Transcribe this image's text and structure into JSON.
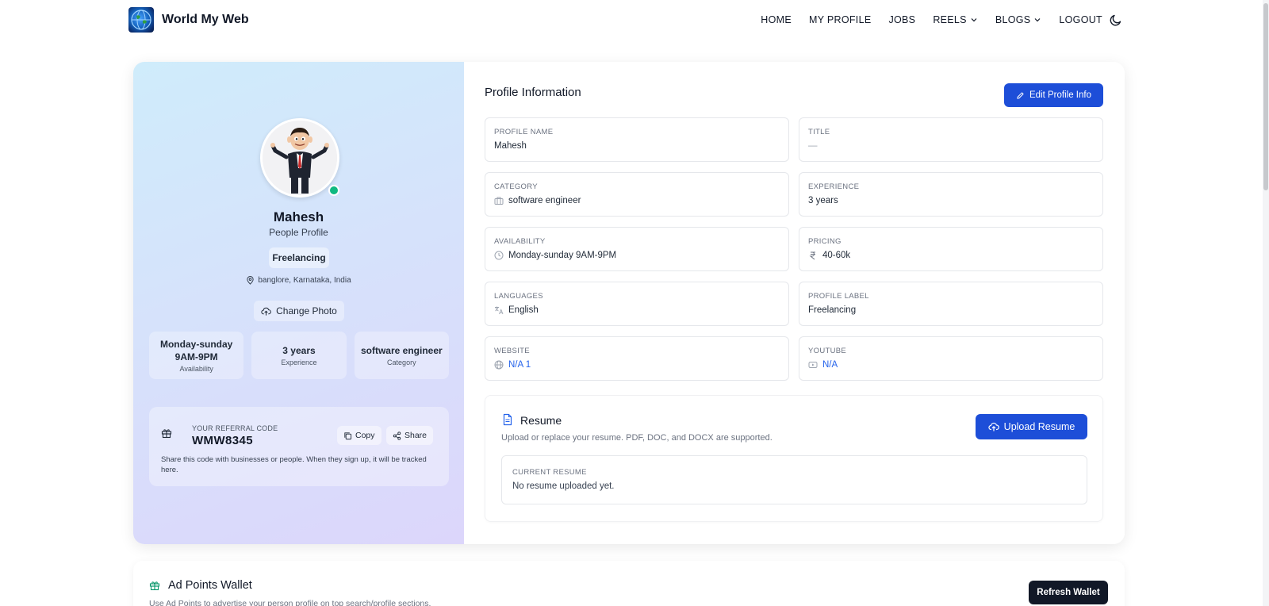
{
  "nav": {
    "brand": "World My Web",
    "items": [
      {
        "label": "HOME",
        "dropdown": false
      },
      {
        "label": "MY PROFILE",
        "dropdown": false
      },
      {
        "label": "JOBS",
        "dropdown": false
      },
      {
        "label": "REELS",
        "dropdown": true
      },
      {
        "label": "BLOGS",
        "dropdown": true
      },
      {
        "label": "LOGOUT",
        "dropdown": false
      }
    ],
    "theme_icon": "moon-icon"
  },
  "profile_card": {
    "name": "Mahesh",
    "type": "People Profile",
    "label": "Freelancing",
    "location": "banglore, Karnataka, India",
    "change_photo": "Change Photo",
    "online_color": "#10b981",
    "stats": [
      {
        "value": "Monday-sunday 9AM-9PM",
        "label": "Availability"
      },
      {
        "value": "3 years",
        "label": "Experience"
      },
      {
        "value": "software engineer",
        "label": "Category"
      }
    ],
    "referral": {
      "title": "YOUR REFERRAL CODE",
      "code": "WMW8345",
      "copy": "Copy",
      "share": "Share",
      "description": "Share this code with businesses or people. When they sign up, it will be tracked here."
    }
  },
  "profile_info": {
    "title": "Profile Information",
    "edit_button": "Edit Profile Info",
    "fields": [
      {
        "label": "PROFILE NAME",
        "value": "Mahesh",
        "icon": "",
        "link": false
      },
      {
        "label": "TITLE",
        "value": "—",
        "icon": "",
        "link": false
      },
      {
        "label": "CATEGORY",
        "value": "software engineer",
        "icon": "briefcase-icon",
        "link": false
      },
      {
        "label": "EXPERIENCE",
        "value": "3 years",
        "icon": "",
        "link": false
      },
      {
        "label": "AVAILABILITY",
        "value": "Monday-sunday 9AM-9PM",
        "icon": "clock-icon",
        "link": false
      },
      {
        "label": "PRICING",
        "value": "40-60k",
        "icon": "rupee-icon",
        "link": false
      },
      {
        "label": "LANGUAGES",
        "value": "English",
        "icon": "translate-icon",
        "link": false
      },
      {
        "label": "PROFILE LABEL",
        "value": "Freelancing",
        "icon": "",
        "link": false
      },
      {
        "label": "WEBSITE",
        "value": "N/A 1",
        "icon": "globe-icon",
        "link": true
      },
      {
        "label": "YOUTUBE",
        "value": "N/A",
        "icon": "youtube-icon",
        "link": true
      }
    ]
  },
  "resume": {
    "title": "Resume",
    "subtitle": "Upload or replace your resume. PDF, DOC, and DOCX are supported.",
    "upload_button": "Upload Resume",
    "current_label": "CURRENT RESUME",
    "current_value": "No resume uploaded yet."
  },
  "wallet": {
    "title": "Ad Points Wallet",
    "subtitle": "Use Ad Points to advertise your person profile on top search/profile sections.",
    "refresh_button": "Refresh Wallet"
  },
  "colors": {
    "primary": "#1d4ed8",
    "dark_button": "#111827",
    "link": "#2563eb"
  }
}
